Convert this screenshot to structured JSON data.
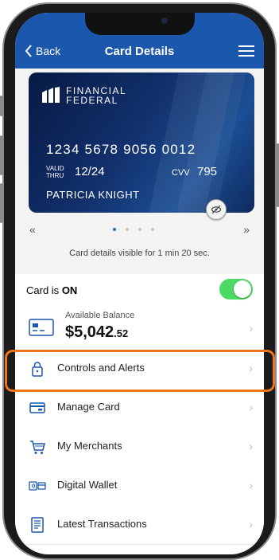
{
  "header": {
    "back_label": "Back",
    "title": "Card Details"
  },
  "card": {
    "brand_line1": "FINANCIAL",
    "brand_line2": "FEDERAL",
    "number": "1234 5678 9056 0012",
    "valid_label_1": "VALID",
    "valid_label_2": "THRU",
    "valid_value": "12/24",
    "cvv_label": "CVV",
    "cvv_value": "795",
    "holder": "PATRICIA KNIGHT"
  },
  "carousel": {
    "prev": "«",
    "next": "»",
    "page_count": 4,
    "active_page": 1
  },
  "visibility_text": "Card details visible for 1 min 20 sec.",
  "card_status": {
    "label": "Card is",
    "state": "ON",
    "enabled": true
  },
  "balance": {
    "label": "Available Balance",
    "amount": "$5,042",
    "cents": ".52"
  },
  "menu_items": [
    {
      "label": "Controls and Alerts",
      "icon": "lock-icon"
    },
    {
      "label": "Manage Card",
      "icon": "card-icon"
    },
    {
      "label": "My Merchants",
      "icon": "cart-icon"
    },
    {
      "label": "Digital Wallet",
      "icon": "wallet-icon"
    },
    {
      "label": "Latest Transactions",
      "icon": "document-icon"
    }
  ],
  "colors": {
    "header": "#1b57ad",
    "toggle_on": "#4cd964",
    "highlight": "#f0731f"
  }
}
